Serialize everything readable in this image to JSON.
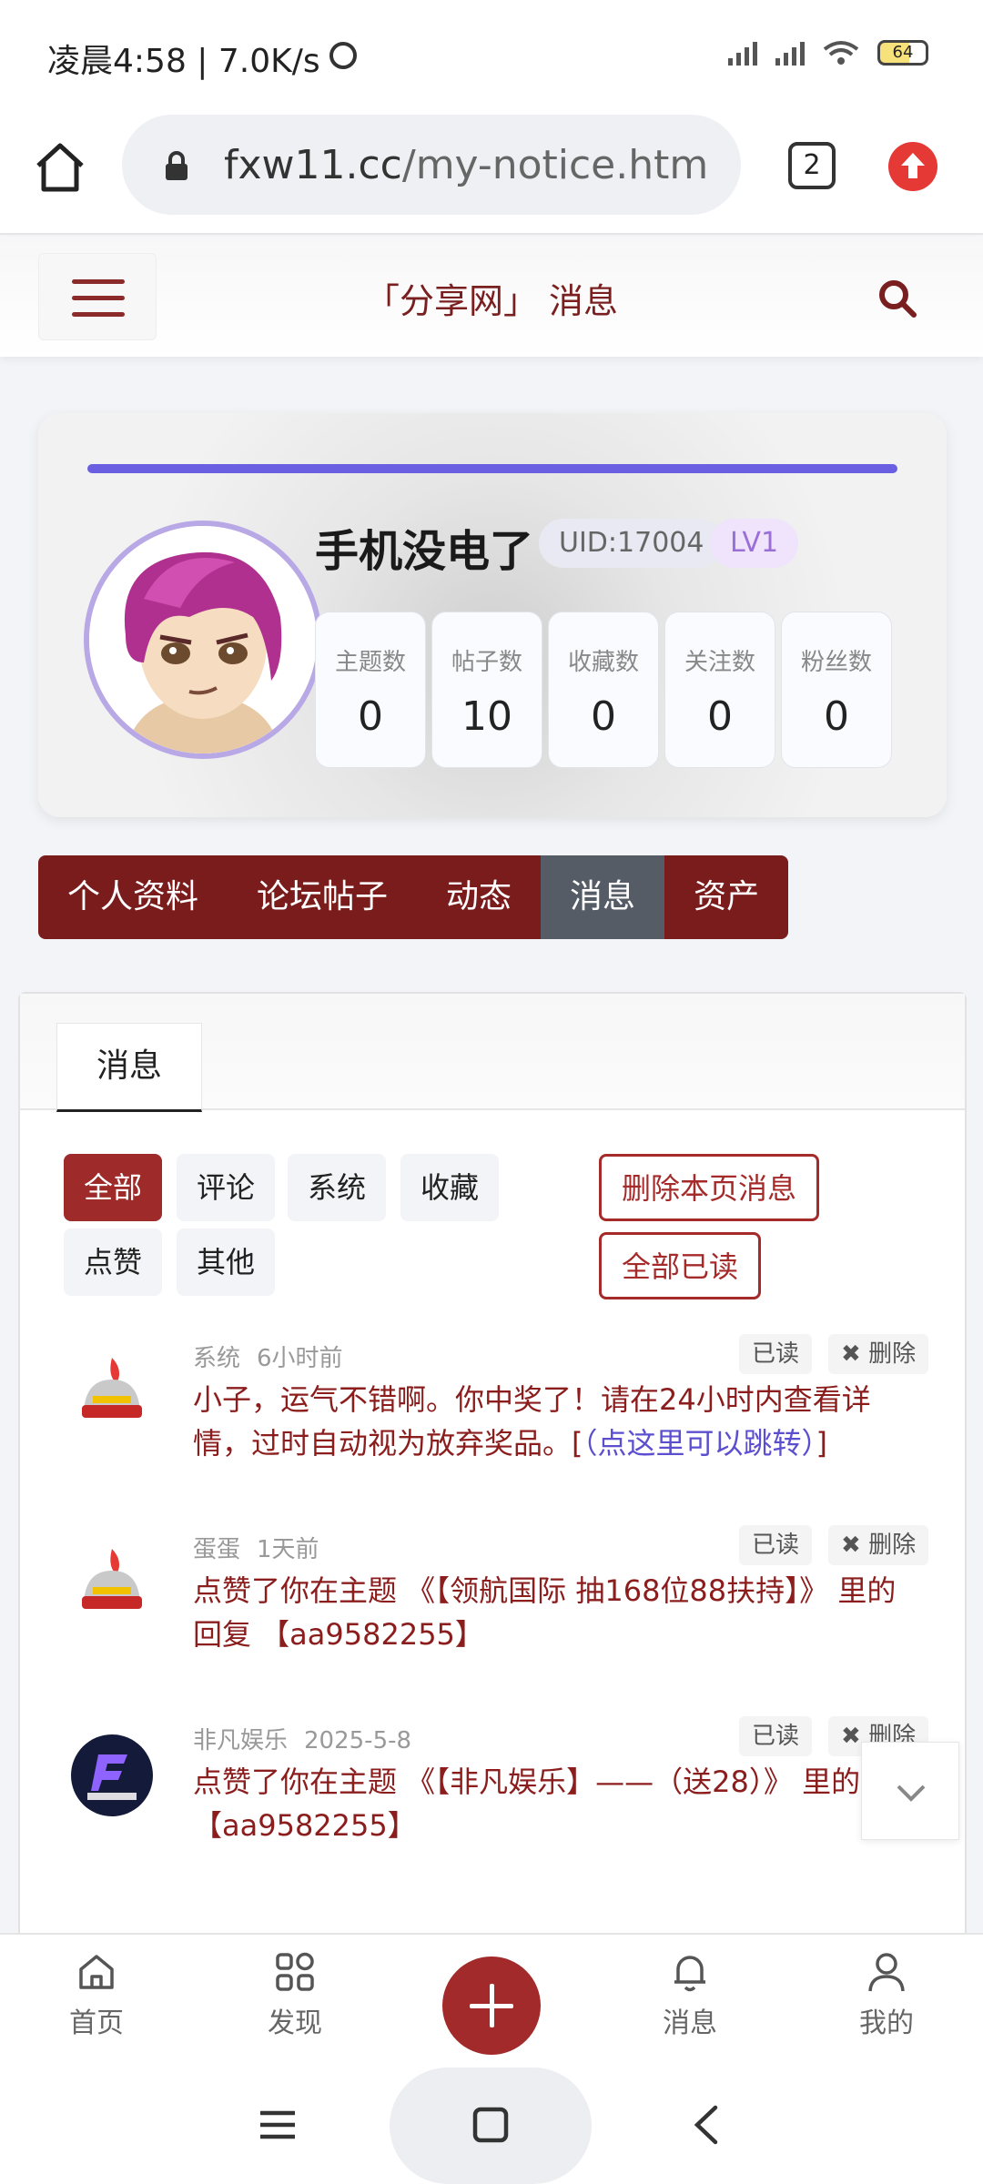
{
  "status_bar": {
    "time": "凌晨4:58 | 7.0K/s",
    "battery": "64"
  },
  "browser": {
    "url_domain": "fxw11.cc",
    "url_path": "/my-notice.htm",
    "tab_count": "2"
  },
  "site_header": {
    "title": "「分享网」 消息"
  },
  "profile": {
    "username": "手机没电了",
    "uid": "UID:17004",
    "level": "LV1",
    "stats": [
      {
        "label": "主题数",
        "value": "0"
      },
      {
        "label": "帖子数",
        "value": "10"
      },
      {
        "label": "收藏数",
        "value": "0"
      },
      {
        "label": "关注数",
        "value": "0"
      },
      {
        "label": "粉丝数",
        "value": "0"
      }
    ]
  },
  "profile_nav": [
    {
      "label": "个人资料"
    },
    {
      "label": "论坛帖子"
    },
    {
      "label": "动态"
    },
    {
      "label": "消息"
    },
    {
      "label": "资产"
    }
  ],
  "panel": {
    "tab": "消息",
    "filters": [
      "全部",
      "评论",
      "系统",
      "收藏",
      "点赞",
      "其他"
    ],
    "delete_page": "删除本页消息",
    "mark_all_read": "全部已读",
    "read_label": "已读",
    "delete_label": "删除"
  },
  "messages": [
    {
      "sender": "系统",
      "time": "6小时前",
      "text": "小子，运气不错啊。你中奖了！请在24小时内查看详情，过时自动视为放弃奖品。[",
      "link": "（点这里可以跳转）",
      "text_end": "]"
    },
    {
      "sender": "蛋蛋",
      "time": "1天前",
      "text": "点赞了你在主题 《【领航国际 抽168位88扶持】》 里的回复 【aa9582255】"
    },
    {
      "sender": "非凡娱乐",
      "time": "2025-5-8",
      "text": "点赞了你在主题 《【非凡娱乐】——（送28）》 里的回复 【aa9582255】"
    }
  ],
  "bottom_nav": [
    {
      "label": "首页"
    },
    {
      "label": "发现"
    },
    {
      "label": "消息"
    },
    {
      "label": "我的"
    }
  ],
  "colors": {
    "brand": "#7a1c1c",
    "accent_purple": "#6a5fe0",
    "link": "#5b4fcf",
    "active_nav": "#565c66"
  }
}
